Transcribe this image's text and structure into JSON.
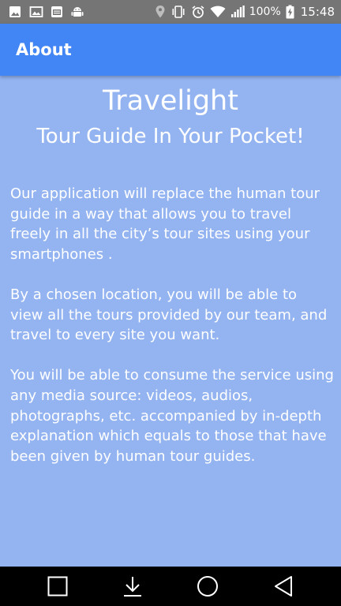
{
  "status_bar": {
    "battery_percent": "100%",
    "time": "15:48",
    "left_icons": [
      "gallery-icon",
      "image-icon",
      "app-badge-icon",
      "android-icon"
    ],
    "right_icons": [
      "location-icon",
      "vibrate-icon",
      "alarm-icon",
      "wifi-icon",
      "signal-icon",
      "battery-charging-icon"
    ]
  },
  "app_bar": {
    "title": "About"
  },
  "content": {
    "headline": "Travelight",
    "subheadline": "Tour Guide In Your Pocket!",
    "paragraphs": [
      "Our application will replace the human tour guide in a way that allows you to travel freely in all the city’s tour sites using your smartphones .",
      "By a chosen location, you will be able to view all the tours provided by our team, and travel to every site you want.",
      "You will be able to consume the service using any media source: videos, audios, photographs, etc. accompanied by in-depth explanation which equals to those that have been given by human tour guides."
    ]
  },
  "nav_bar": {
    "buttons": [
      "overview-button",
      "notifications-pull-button",
      "home-button",
      "back-button"
    ]
  },
  "colors": {
    "status_bar": "#757575",
    "app_bar": "#4285f4",
    "background": "#93b3f1",
    "text": "#ffffff",
    "nav_bar": "#000000"
  }
}
